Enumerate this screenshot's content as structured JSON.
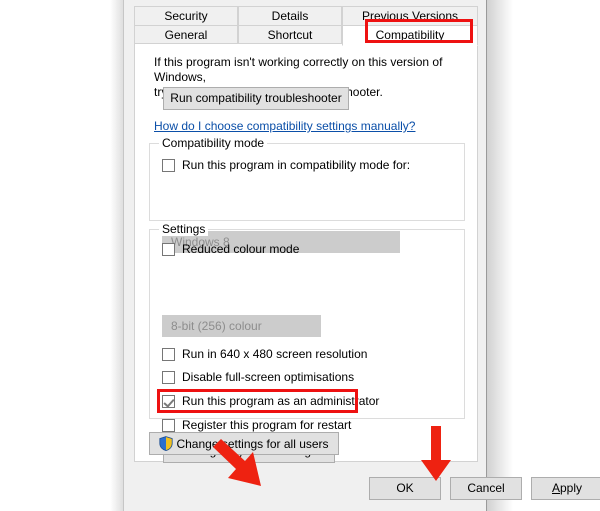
{
  "dialog": {
    "tabs": [
      {
        "label": "Security",
        "selected": false,
        "row": 1
      },
      {
        "label": "Details",
        "selected": false,
        "row": 1
      },
      {
        "label": "Previous Versions",
        "selected": false,
        "row": 1
      },
      {
        "label": "General",
        "selected": false,
        "row": 2
      },
      {
        "label": "Shortcut",
        "selected": false,
        "row": 2
      },
      {
        "label": "Compatibility",
        "selected": true,
        "row": 2
      }
    ],
    "intro_line1": "If this program isn't working correctly on this version of Windows,",
    "intro_line2": "try running the compatibility troubleshooter.",
    "troubleshooter_button": "Run compatibility troubleshooter",
    "help_link": "How do I choose compatibility settings manually?",
    "compatibility_mode": {
      "group_label": "Compatibility mode",
      "checkbox_label": "Run this program in compatibility mode for:",
      "checkbox_checked": false,
      "combo_value": "Windows 8",
      "combo_disabled": true
    },
    "settings": {
      "group_label": "Settings",
      "reduced_colour_label": "Reduced colour mode",
      "reduced_colour_checked": false,
      "colour_combo_value": "8-bit (256) colour",
      "colour_combo_disabled": true,
      "items": [
        {
          "label": "Run in 640 x 480 screen resolution",
          "checked": false
        },
        {
          "label": "Disable full-screen optimisations",
          "checked": false
        },
        {
          "label": "Run this program as an administrator",
          "checked": true
        },
        {
          "label": "Register this program for restart",
          "checked": false
        }
      ],
      "dpi_button": "Change high DPI settings"
    },
    "all_users_button": "Change settings for all users",
    "buttons": {
      "ok": "OK",
      "cancel": "Cancel",
      "apply_prefix": "A",
      "apply_rest": "pply"
    }
  },
  "annotations": {
    "highlight_color": "#ee1111",
    "arrow_color": "#ee2211",
    "highlighted_tab": "Compatibility",
    "highlighted_checkbox": "Run this program as an administrator",
    "arrow_targets": [
      "OK",
      "Apply"
    ]
  },
  "colors": {
    "dialog_background": "#f0f0f0",
    "page_background": "#ffffff",
    "button_face": "#e1e1e1",
    "button_border": "#adadad",
    "link": "#0b4fa8",
    "disabled_combo": "#cccccc",
    "disabled_text": "#8d8d8d"
  }
}
